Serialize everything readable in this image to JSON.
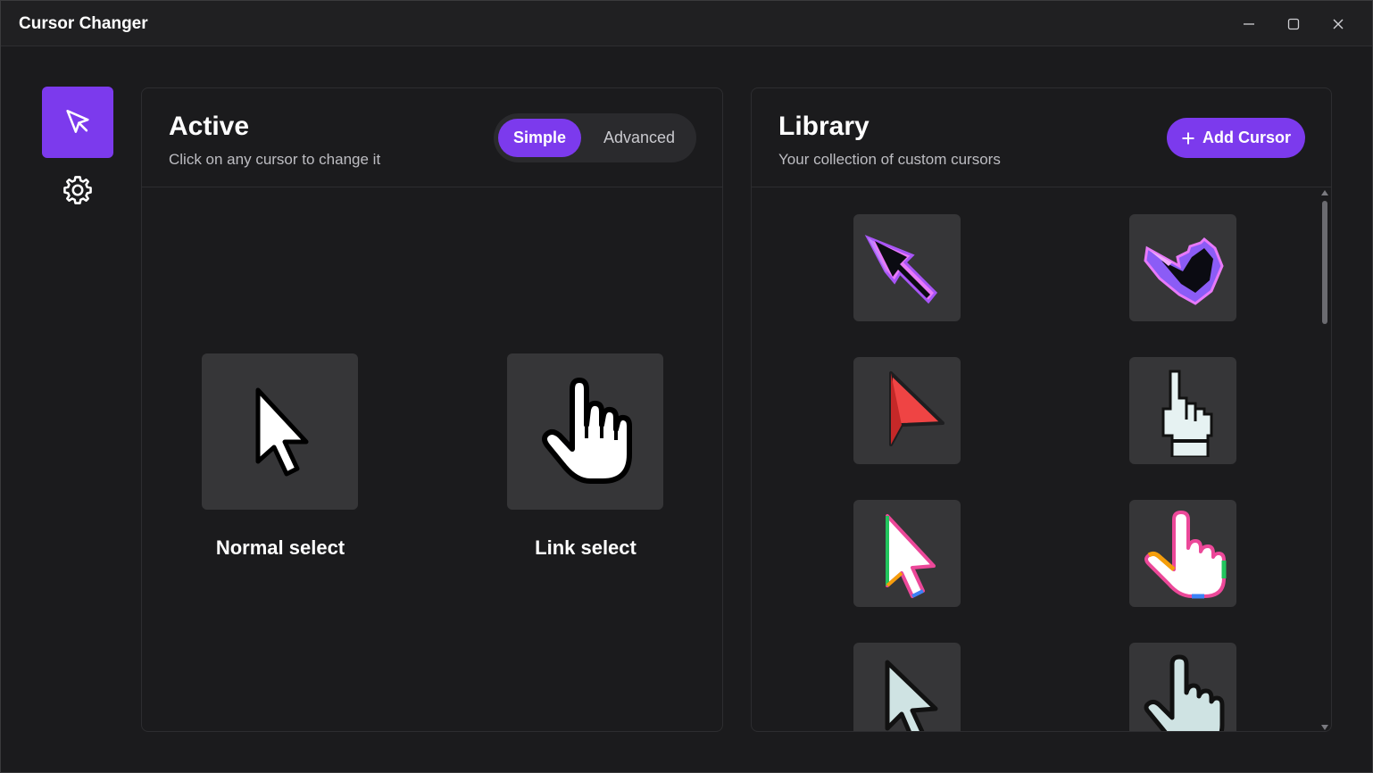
{
  "window": {
    "title": "Cursor Changer",
    "controls": {
      "minimize": "minimize-icon",
      "maximize": "maximize-icon",
      "close": "close-icon"
    }
  },
  "nav": {
    "items": [
      {
        "id": "cursors",
        "icon": "cursor-pointer-icon",
        "active": true
      },
      {
        "id": "settings",
        "icon": "gear-icon",
        "active": false
      }
    ]
  },
  "active_panel": {
    "title": "Active",
    "subtitle": "Click on any cursor to change it",
    "mode_toggle": {
      "options": [
        "Simple",
        "Advanced"
      ],
      "selected": "Simple"
    },
    "cursors": [
      {
        "label": "Normal select",
        "icon": "arrow-cursor-icon"
      },
      {
        "label": "Link select",
        "icon": "hand-cursor-icon"
      }
    ]
  },
  "library_panel": {
    "title": "Library",
    "subtitle": "Your collection of custom cursors",
    "add_button": "Add Cursor",
    "cursors": [
      {
        "icon": "purple-pixel-arrow-icon",
        "accent": "#a855f7"
      },
      {
        "icon": "purple-pixel-hand-icon",
        "accent": "#a855f7"
      },
      {
        "icon": "red-arrow-icon",
        "accent": "#ef4444"
      },
      {
        "icon": "white-pixel-hand-icon",
        "accent": "#e6f2f2"
      },
      {
        "icon": "rainbow-arrow-icon",
        "accent": "#ec4899"
      },
      {
        "icon": "rainbow-hand-icon",
        "accent": "#f59e0b"
      },
      {
        "icon": "pale-arrow-icon",
        "accent": "#cfe3e3"
      },
      {
        "icon": "pale-hand-icon",
        "accent": "#cfe3e3"
      }
    ]
  },
  "colors": {
    "accent": "#7c3aed",
    "background": "#1b1b1d",
    "card": "#363638"
  }
}
